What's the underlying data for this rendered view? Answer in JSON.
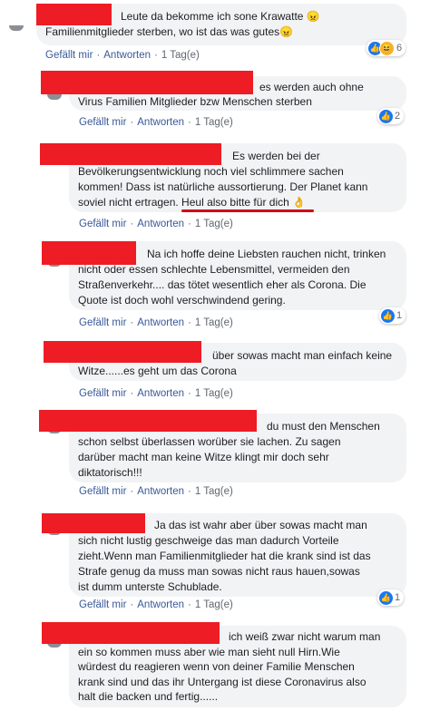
{
  "comments": [
    {
      "text": "Leute da bekomme ich sone Krawatte 😠\nFamilienmitglieder sterben, wo ist das was gutes😠",
      "actions": {
        "like": "Gefällt mir",
        "reply": "Antworten",
        "time": "1 Tag(e)"
      },
      "reactions": {
        "count": "6",
        "icons": [
          "like-icon",
          "haha-icon"
        ]
      }
    },
    {
      "text": "es werden auch ohne\nVirus Familien Mitglieder bzw Menschen sterben",
      "actions": {
        "like": "Gefällt mir",
        "reply": "Antworten",
        "time": "1 Tag(e)"
      },
      "reactions": {
        "count": "2",
        "icons": [
          "like-icon"
        ]
      }
    },
    {
      "text": "Es werden bei der\nBevölkerungsentwicklung noch viel schlimmere sachen\nkommen! Dass ist natürliche aussortierung. Der Planet kann\nsoviel nicht ertragen. Heul also bitte für dich 👌",
      "actions": {
        "like": "Gefällt mir",
        "reply": "Antworten",
        "time": "1 Tag(e)"
      }
    },
    {
      "text": "Na ich hoffe deine Liebsten rauchen nicht, trinken\nnicht oder essen schlechte Lebensmittel, vermeiden den\nStraßenverkehr.... das tötet wesentlich eher als Corona. Die\nQuote ist doch wohl verschwindend gering.",
      "actions": {
        "like": "Gefällt mir",
        "reply": "Antworten",
        "time": "1 Tag(e)"
      },
      "reactions": {
        "count": "1",
        "icons": [
          "like-icon"
        ]
      }
    },
    {
      "text": "über sowas macht man einfach keine\nWitze......es geht um das Corona",
      "actions": {
        "like": "Gefällt mir",
        "reply": "Antworten",
        "time": "1 Tag(e)"
      }
    },
    {
      "text": "du must den Menschen\nschon selbst überlassen worüber sie lachen. Zu sagen\ndarüber macht man keine Witze klingt mir doch sehr\ndiktatorisch!!!",
      "actions": {
        "like": "Gefällt mir",
        "reply": "Antworten",
        "time": "1 Tag(e)"
      }
    },
    {
      "text": "Ja das ist wahr aber über sowas macht man\nsich nicht lustig geschweige das man dadurch Vorteile\nzieht.Wenn man Familienmitglieder hat die krank sind ist das\nStrafe genug da muss man sowas nicht raus hauen,sowas\nist dumm unterste Schublade.",
      "actions": {
        "like": "Gefällt mir",
        "reply": "Antworten",
        "time": "1 Tag(e)"
      },
      "reactions": {
        "count": "1",
        "icons": [
          "like-icon"
        ]
      }
    },
    {
      "text": "ich weiß zwar nicht warum man\nein so kommen muss aber wie man sieht null Hirn.Wie\nwürdest du reagieren wenn von deiner Familie Menschen\nkrank sind und das ihr Untergang ist diese Coronavirus also\nhalt die backen und fertig......"
    }
  ],
  "colors": {
    "bubble": "#f2f3f5",
    "redaction": "#ee1c25",
    "link": "#385898",
    "meta": "#606770",
    "like": "#1877f2"
  }
}
